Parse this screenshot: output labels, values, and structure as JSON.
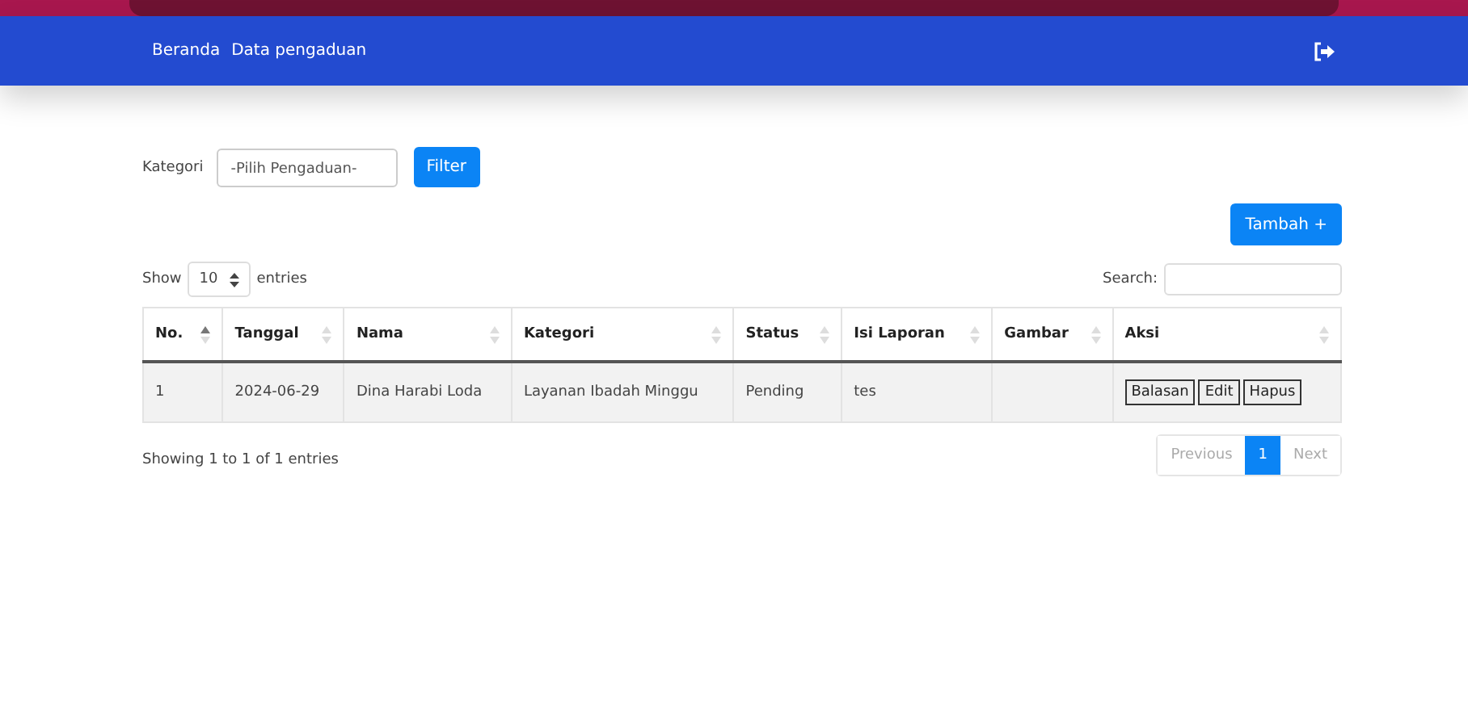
{
  "navbar": {
    "links": [
      {
        "label": "Beranda"
      },
      {
        "label": "Data pengaduan"
      }
    ]
  },
  "filter": {
    "label": "Kategori",
    "select_placeholder": "-Pilih Pengaduan-",
    "button": "Filter"
  },
  "add_button": "Tambah +",
  "table_controls": {
    "show_label": "Show",
    "page_length": "10",
    "entries_label": "entries",
    "search_label": "Search:"
  },
  "table": {
    "columns": [
      {
        "label": "No.",
        "sorted_asc": true
      },
      {
        "label": "Tanggal",
        "sorted_asc": false
      },
      {
        "label": "Nama",
        "sorted_asc": false
      },
      {
        "label": "Kategori",
        "sorted_asc": false
      },
      {
        "label": "Status",
        "sorted_asc": false
      },
      {
        "label": "Isi Laporan",
        "sorted_asc": false
      },
      {
        "label": "Gambar",
        "sorted_asc": false
      },
      {
        "label": "Aksi",
        "sorted_asc": false
      }
    ],
    "rows": [
      {
        "cells": [
          "1",
          "2024-06-29",
          "Dina Harabi Loda",
          "Layanan Ibadah Minggu",
          "Pending",
          "tes",
          ""
        ],
        "actions": [
          "Balasan",
          "Edit",
          "Hapus"
        ]
      }
    ]
  },
  "info": "Showing 1 to 1 of 1 entries",
  "pagination": [
    {
      "label": "Previous",
      "disabled": true,
      "selected": false
    },
    {
      "label": "1",
      "disabled": false,
      "selected": true
    },
    {
      "label": "Next",
      "disabled": true,
      "selected": false
    }
  ]
}
